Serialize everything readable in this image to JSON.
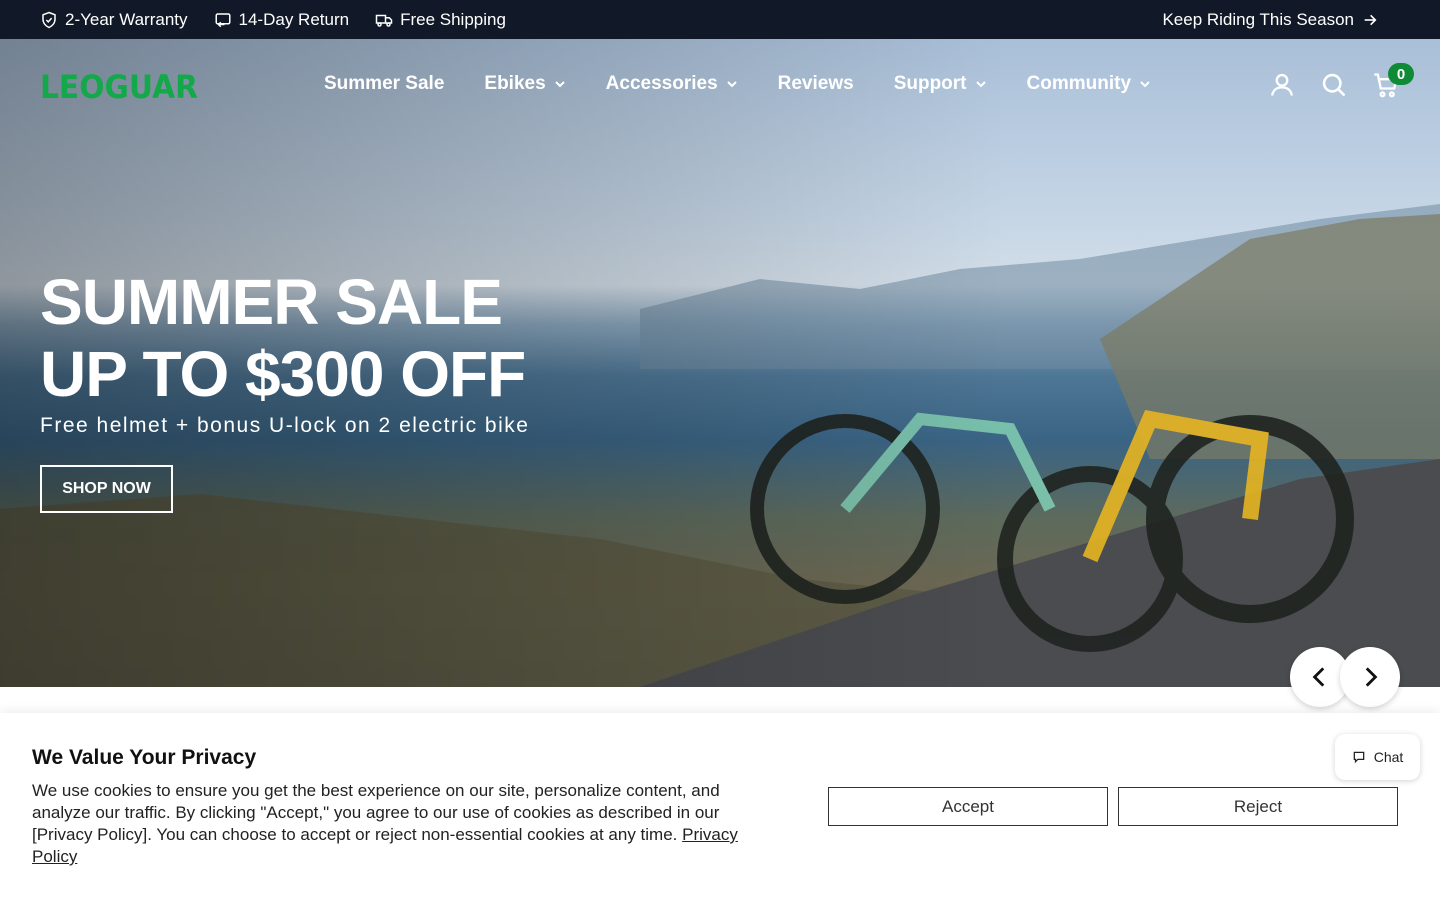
{
  "topbar": {
    "perks": [
      {
        "icon": "shield-check-icon",
        "label": "2-Year Warranty"
      },
      {
        "icon": "return-icon",
        "label": "14-Day Return"
      },
      {
        "icon": "truck-icon",
        "label": "Free Shipping"
      }
    ],
    "promo": "Keep Riding This Season"
  },
  "brand": {
    "logo_text": "LEOGUAR",
    "logo_color": "#13a84a"
  },
  "nav": {
    "items": [
      {
        "label": "Summer Sale",
        "dropdown": false
      },
      {
        "label": "Ebikes",
        "dropdown": true
      },
      {
        "label": "Accessories",
        "dropdown": true
      },
      {
        "label": "Reviews",
        "dropdown": false
      },
      {
        "label": "Support",
        "dropdown": true
      },
      {
        "label": "Community",
        "dropdown": true
      }
    ],
    "cart_count": "0"
  },
  "hero": {
    "title_line1": "SUMMER SALE",
    "title_line2": "UP TO $300 OFF",
    "subtitle": "Free helmet + bonus U-lock on 2 electric bike",
    "cta": "SHOP NOW"
  },
  "privacy": {
    "title": "We Value Your Privacy",
    "text": "We use cookies to ensure you get the best experience on our site, personalize content, and analyze our traffic. By clicking \"Accept,\" you agree to our use of cookies as described in our [Privacy Policy]. You can choose to accept or reject non-essential cookies at any time.",
    "link": "Privacy Policy",
    "accept": "Accept",
    "reject": "Reject"
  },
  "chat": {
    "label": "Chat"
  }
}
